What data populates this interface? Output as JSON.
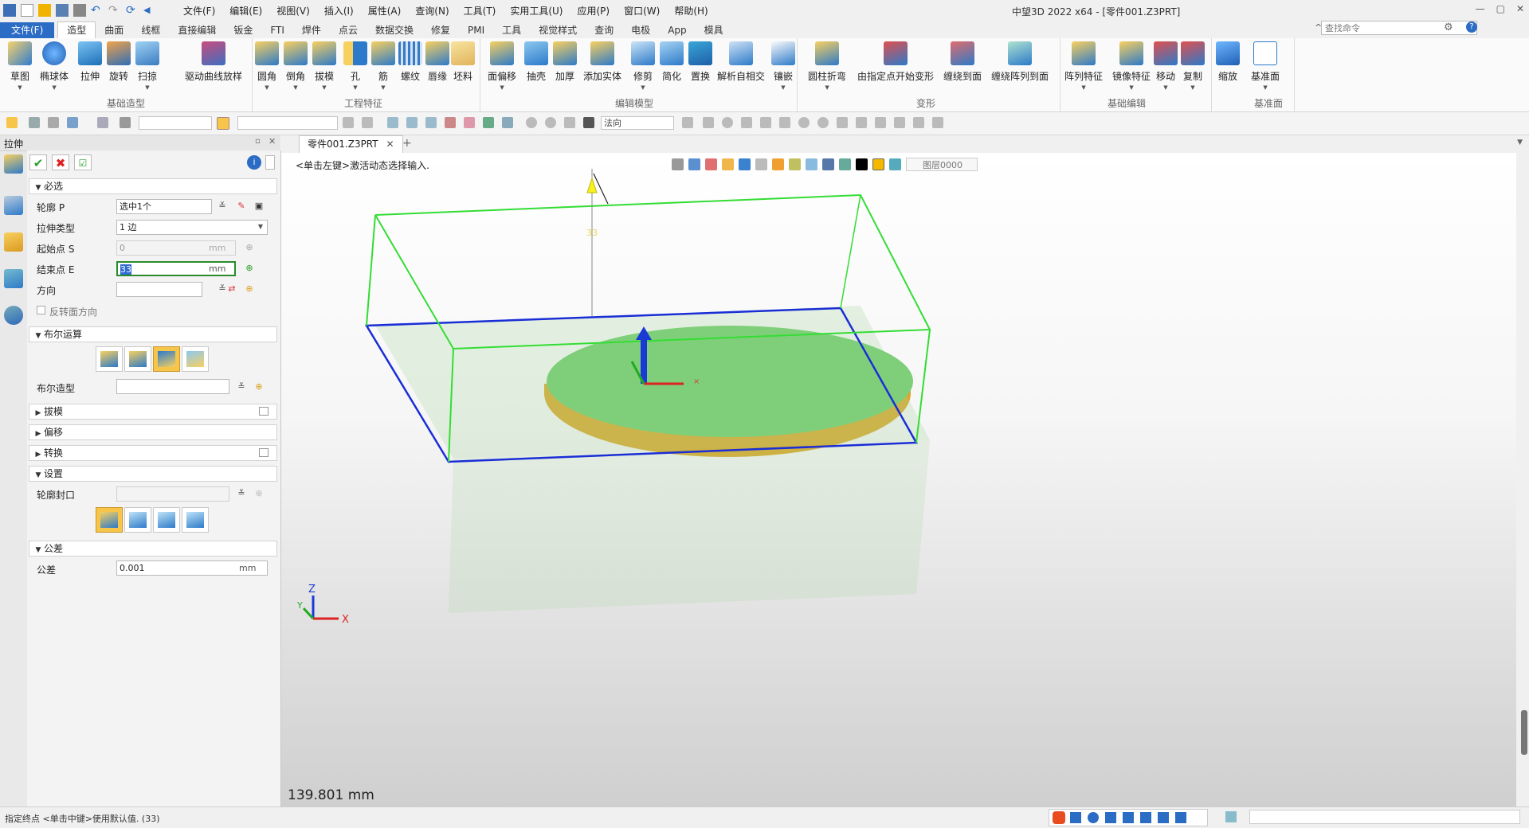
{
  "app": {
    "window_title": "中望3D 2022 x64 - [零件001.Z3PRT]",
    "menu": [
      "文件(F)",
      "编辑(E)",
      "视图(V)",
      "插入(I)",
      "属性(A)",
      "查询(N)",
      "工具(T)",
      "实用工具(U)",
      "应用(P)",
      "窗口(W)",
      "帮助(H)"
    ],
    "search_placeholder": "查找命令"
  },
  "ribbon_tabs": [
    "文件(F)",
    "造型",
    "曲面",
    "线框",
    "直接编辑",
    "钣金",
    "FTI",
    "焊件",
    "点云",
    "数据交换",
    "修复",
    "PMI",
    "工具",
    "视觉样式",
    "查询",
    "电极",
    "App",
    "模具"
  ],
  "ribbon_groups": [
    {
      "label": "基础造型",
      "buttons": [
        "草图",
        "椭球体",
        "拉伸",
        "旋转",
        "扫掠",
        "驱动曲线放样"
      ]
    },
    {
      "label": "工程特征",
      "buttons": [
        "圆角",
        "倒角",
        "拔模",
        "孔",
        "筋",
        "螺纹",
        "唇缘",
        "坯料"
      ]
    },
    {
      "label": "编辑模型",
      "buttons": [
        "面偏移",
        "抽壳",
        "加厚",
        "添加实体",
        "修剪",
        "简化",
        "置换",
        "解析自相交",
        "镶嵌"
      ]
    },
    {
      "label": "变形",
      "buttons": [
        "圆柱折弯",
        "由指定点开始变形",
        "缠绕到面",
        "缠绕阵列到面"
      ]
    },
    {
      "label": "基础编辑",
      "buttons": [
        "阵列特征",
        "镜像特征",
        "移动",
        "复制",
        "缩放"
      ]
    },
    {
      "label": "基准面",
      "buttons": [
        "基准面"
      ]
    }
  ],
  "toolbar2": {
    "filter_value": "法向"
  },
  "panel": {
    "title": "拉伸",
    "sections": {
      "required": "必选",
      "boolean": "布尔运算",
      "draft": "拔模",
      "offset": "偏移",
      "transform": "转换",
      "settings": "设置",
      "tolerance": "公差"
    },
    "fields": {
      "profile_label": "轮廓 P",
      "profile_value": "选中1个",
      "extrude_type_label": "拉伸类型",
      "extrude_type_value": "1 边",
      "start_label": "起始点 S",
      "start_value": "0",
      "end_label": "结束点 E",
      "end_value": "33",
      "direction_label": "方向",
      "flip_label": "反转面方向",
      "boolean_shape_label": "布尔造型",
      "profile_cap_label": "轮廓封口",
      "tolerance_label": "公差",
      "tolerance_value": "0.001",
      "unit": "mm"
    }
  },
  "document": {
    "tab": "零件001.Z3PRT",
    "prompt": "<单击左键>激活动态选择输入.",
    "layer": "图层0000",
    "measure": "139.801 mm",
    "handle_value": "33"
  },
  "status": {
    "text": "指定终点  <单击中键>使用默认值. (33)"
  },
  "colors": {
    "accent": "#2b6cc4",
    "selected_button": "#f6c54a",
    "box_green": "#33dd33",
    "box_blue": "#1a2ed6",
    "disk_top": "#7fcf7a",
    "disk_side": "#e3b42e"
  }
}
